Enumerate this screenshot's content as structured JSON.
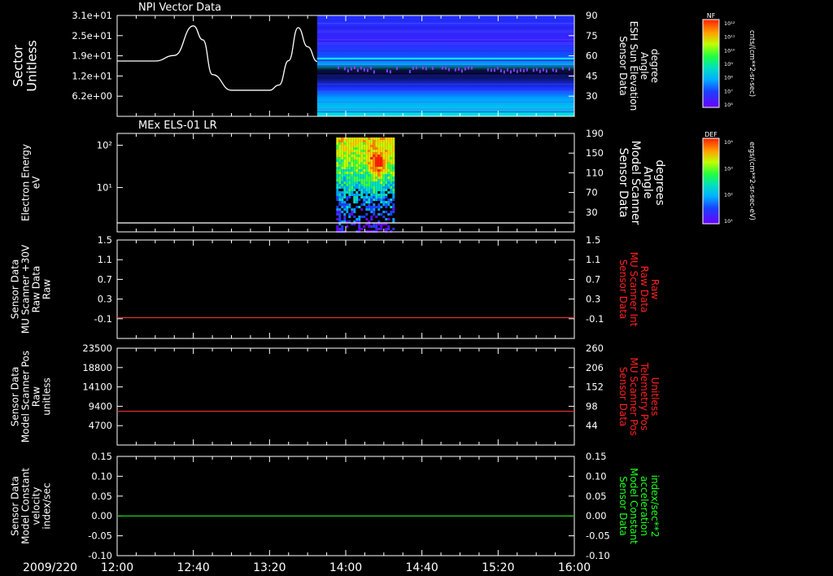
{
  "figure": {
    "date_label": "2009/220",
    "background": "#000000",
    "axis_color": "#ffffff",
    "time_ticks": [
      "12:00",
      "12:40",
      "13:20",
      "14:00",
      "14:40",
      "15:20",
      "16:00"
    ]
  },
  "colorbars": [
    {
      "title": "NF",
      "unit": "cnts/(cm**2-sr-sec)",
      "ticks": [
        "10¹²",
        "10¹¹",
        "10¹⁰",
        "10⁹",
        "10⁸",
        "10⁷",
        "10⁶"
      ]
    },
    {
      "title": "DEF",
      "unit": "ergs/(cm**2-sr-sec-eV)",
      "ticks": [
        "10⁴",
        "10³",
        "10²",
        "10¹"
      ]
    }
  ],
  "chart_data": [
    {
      "type": "line",
      "title": "NPI Vector Data",
      "ylabel_left": [
        "Sector",
        "Unitless"
      ],
      "ylabel_right": [
        "Sensor Data",
        "ESH Sun Elevation",
        "Angle",
        "degree"
      ],
      "ylabel_right_color": "#ffffff",
      "left_ticks": [
        "3.1e+01",
        "2.5e+01",
        "1.9e+01",
        "1.2e+01",
        "6.2e+00"
      ],
      "right_ticks": [
        "90",
        "75",
        "60",
        "45",
        "30"
      ],
      "series": [
        {
          "x": [
            "12:00",
            "12:20",
            "12:30",
            "12:40",
            "12:45",
            "12:50",
            "13:00",
            "13:10",
            "13:20",
            "13:25",
            "13:30",
            "13:35",
            "13:40",
            "13:45"
          ],
          "y": [
            17.9,
            17.9,
            19.5,
            28.0,
            24.0,
            14.0,
            9.5,
            9.5,
            9.5,
            11.0,
            18.0,
            27.5,
            22.0,
            17.8
          ],
          "color": "#ffffff"
        }
      ],
      "spectrogram": {
        "x_start": "13:45",
        "x_end": "16:00",
        "y_range": [
          15,
          90
        ],
        "colorbar": "NF"
      }
    },
    {
      "type": "heatmap",
      "title": "MEx ELS-01 LR",
      "ylabel_left": [
        "Electron Energy",
        "eV"
      ],
      "ylabel_right": [
        "Sensor Data",
        "Model Scanner",
        "Angle",
        "degrees"
      ],
      "ylabel_right_color": "#ffffff",
      "left_ticks": [
        "10²",
        "10¹"
      ],
      "right_ticks": [
        "190",
        "150",
        "110",
        "70",
        "30"
      ],
      "yscale": "log",
      "spectrogram": {
        "x_start": "13:55",
        "x_end": "14:25",
        "y_range_eV": [
          2,
          150
        ],
        "colorbar": "DEF"
      },
      "series": [
        {
          "name": "Model Scanner Angle",
          "x": [
            "12:00",
            "16:00"
          ],
          "y": [
            2.5,
            2.5
          ],
          "color": "#ffffff"
        }
      ]
    },
    {
      "type": "line",
      "ylabel_left": [
        "Sensor Data",
        "MU Scanner +30V",
        "Raw Data",
        "Raw"
      ],
      "ylabel_right": [
        "Sensor Data",
        "MU Scanner Int",
        "Raw Data",
        "Raw"
      ],
      "ylabel_right_color": "#ff2020",
      "left_ticks": [
        "1.5",
        "1.1",
        "0.7",
        "0.3",
        "-0.1"
      ],
      "right_ticks": [
        "1.5",
        "1.1",
        "0.7",
        "0.3",
        "-0.1"
      ],
      "ylim": [
        -0.4,
        1.5
      ],
      "series": [
        {
          "x": [
            "12:00",
            "16:00"
          ],
          "y": [
            0.0,
            0.0
          ],
          "color": "#e03030"
        }
      ]
    },
    {
      "type": "line",
      "ylabel_left": [
        "Sensor Data",
        "Model Scanner Pos",
        "Raw",
        "unitless"
      ],
      "ylabel_right": [
        "Sensor Data",
        "MU Scanner Pos",
        "Telemetry Pos",
        "Unitless"
      ],
      "ylabel_right_color": "#ff2020",
      "left_ticks": [
        "23500",
        "18800",
        "14100",
        "9400",
        "4700"
      ],
      "right_ticks": [
        "260",
        "206",
        "152",
        "98",
        "44"
      ],
      "ylim": [
        0,
        23500
      ],
      "series": [
        {
          "x": [
            "12:00",
            "16:00"
          ],
          "y": [
            8200,
            8200
          ],
          "color": "#e03030"
        }
      ]
    },
    {
      "type": "line",
      "ylabel_left": [
        "Sensor Data",
        "Model Constant",
        "velocity",
        "index/sec"
      ],
      "ylabel_right": [
        "Sensor Data",
        "Model Constant",
        "acceleration",
        "index/sec**2"
      ],
      "ylabel_right_color": "#20ff20",
      "left_ticks": [
        "0.15",
        "0.10",
        "0.05",
        "0.00",
        "-0.05",
        "-0.10"
      ],
      "right_ticks": [
        "0.15",
        "0.10",
        "0.05",
        "0.00",
        "-0.05",
        "-0.10"
      ],
      "ylim": [
        -0.1,
        0.15
      ],
      "series": [
        {
          "x": [
            "12:00",
            "16:00"
          ],
          "y": [
            0.0,
            0.0
          ],
          "color": "#20c020"
        }
      ]
    }
  ]
}
